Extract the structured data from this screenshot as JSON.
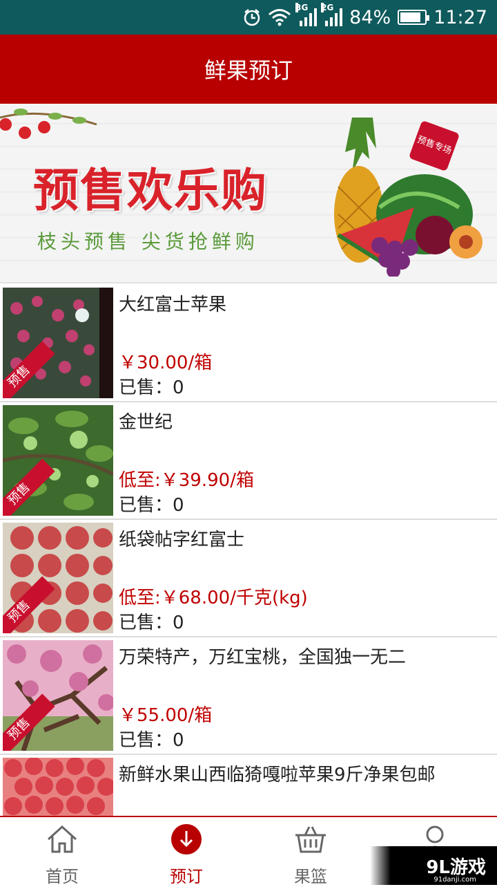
{
  "status_bar": {
    "net_3g": "3G",
    "net_2g": "2G",
    "battery": "84%",
    "battery_level": 0.84,
    "time": "11:27",
    "icons": [
      "alarm-icon",
      "wifi-icon",
      "signal-icon",
      "battery-icon"
    ]
  },
  "header": {
    "title": "鲜果预订"
  },
  "banner": {
    "title": "预售欢乐购",
    "subtitle": "枝头预售 尖货抢鲜购",
    "tag": "预售专场"
  },
  "ribbon_label": "预售",
  "products": [
    {
      "name": "大红富士苹果",
      "price": "￥30.00/箱",
      "sold": "已售：0"
    },
    {
      "name": "金世纪",
      "price": "低至:￥39.90/箱",
      "sold": "已售：0"
    },
    {
      "name": "纸袋帖字红富士",
      "price": "低至:￥68.00/千克(kg)",
      "sold": "已售：0"
    },
    {
      "name": "万荣特产，万红宝桃，全国独一无二",
      "price": "￥55.00/箱",
      "sold": "已售：0"
    },
    {
      "name": "新鲜水果山西临猗嘎啦苹果9斤净果包邮",
      "price": "",
      "sold": ""
    }
  ],
  "tabs": [
    {
      "label": "首页",
      "icon": "home-icon"
    },
    {
      "label": "预订",
      "icon": "download-circle-icon"
    },
    {
      "label": "果篮",
      "icon": "basket-icon"
    },
    {
      "label": "",
      "icon": "user-icon"
    }
  ],
  "watermark": {
    "logo": "9L游戏",
    "url": "91danji.com"
  },
  "colors": {
    "header": "#b80000",
    "price": "#c00000",
    "status_bar": "#0f5a5c",
    "active_tab": "#b80000"
  }
}
